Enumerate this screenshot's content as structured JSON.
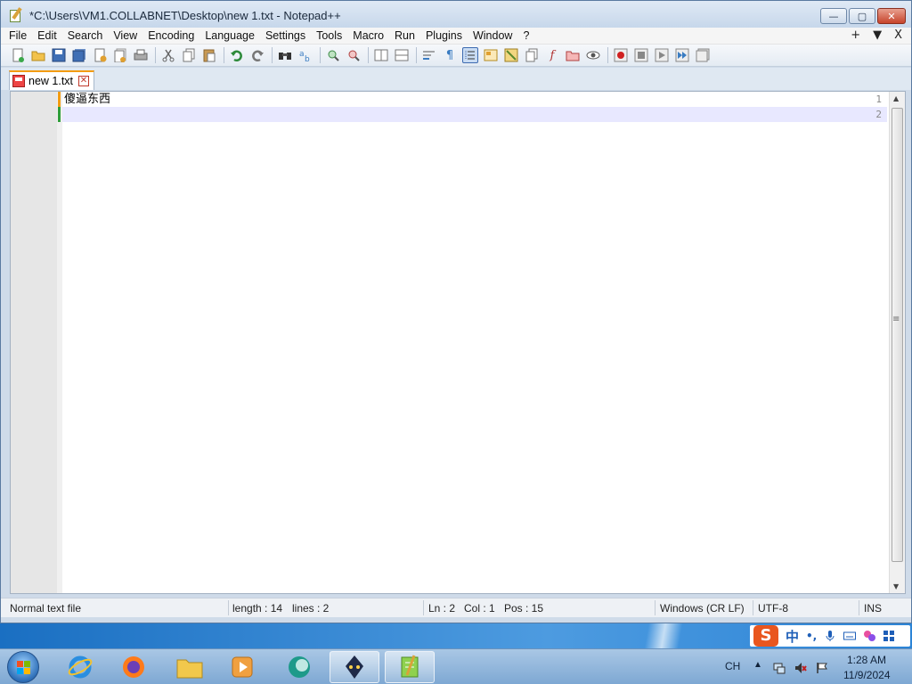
{
  "window": {
    "title": "*C:\\Users\\VM1.COLLABNET\\Desktop\\new 1.txt - Notepad++",
    "controls": {
      "minimize": "—",
      "maximize": "▢",
      "close": "✕"
    }
  },
  "menu": {
    "items": [
      "File",
      "Edit",
      "Search",
      "View",
      "Encoding",
      "Language",
      "Settings",
      "Tools",
      "Macro",
      "Run",
      "Plugins",
      "Window",
      "?"
    ],
    "right": [
      "+",
      "▼",
      "X"
    ]
  },
  "toolbar": {
    "icons": [
      "new-file-icon",
      "open-file-icon",
      "save-icon",
      "save-all-icon",
      "close-icon",
      "close-all-icon",
      "print-icon",
      "cut-icon",
      "copy-icon",
      "paste-icon",
      "undo-icon",
      "redo-icon",
      "find-icon",
      "replace-icon",
      "zoom-in-icon",
      "zoom-out-icon",
      "sync-vertical-icon",
      "sync-horizontal-icon",
      "word-wrap-icon",
      "show-all-chars-icon",
      "indent-guide-icon",
      "udl-icon",
      "doc-map-icon",
      "doc-list-icon",
      "function-list-icon",
      "folder-workspace-icon",
      "monitoring-icon",
      "record-macro-icon",
      "stop-macro-icon",
      "play-macro-icon",
      "run-macro-multiple-icon",
      "save-macro-icon"
    ]
  },
  "tabs": [
    {
      "label": "new 1.txt",
      "close": "✕"
    }
  ],
  "editor": {
    "lines": [
      {
        "number": "1",
        "text": "傻逼东西"
      },
      {
        "number": "2",
        "text": ""
      }
    ]
  },
  "status": {
    "file_type": "Normal text file",
    "length": "length : 14",
    "lines": "lines : 2",
    "ln": "Ln : 2",
    "col": "Col : 1",
    "pos": "Pos : 15",
    "eol": "Windows (CR LF)",
    "encoding": "UTF-8",
    "mode": "INS"
  },
  "ime": {
    "logo": "S",
    "mode": "中",
    "punct": "•,"
  },
  "taskbar": {
    "apps": [
      "internet-explorer-icon",
      "firefox-icon",
      "file-explorer-icon",
      "media-player-icon",
      "app-icon",
      "app-robot-icon",
      "notepadpp-icon"
    ],
    "language": "CH",
    "time": "1:28 AM",
    "date": "11/9/2024"
  },
  "colors": {
    "accent_tab": "#f39c12",
    "current_line": "#e8e8ff",
    "modified_line_marker": "#f39c12",
    "saved_line_marker": "#2e9e3a"
  }
}
